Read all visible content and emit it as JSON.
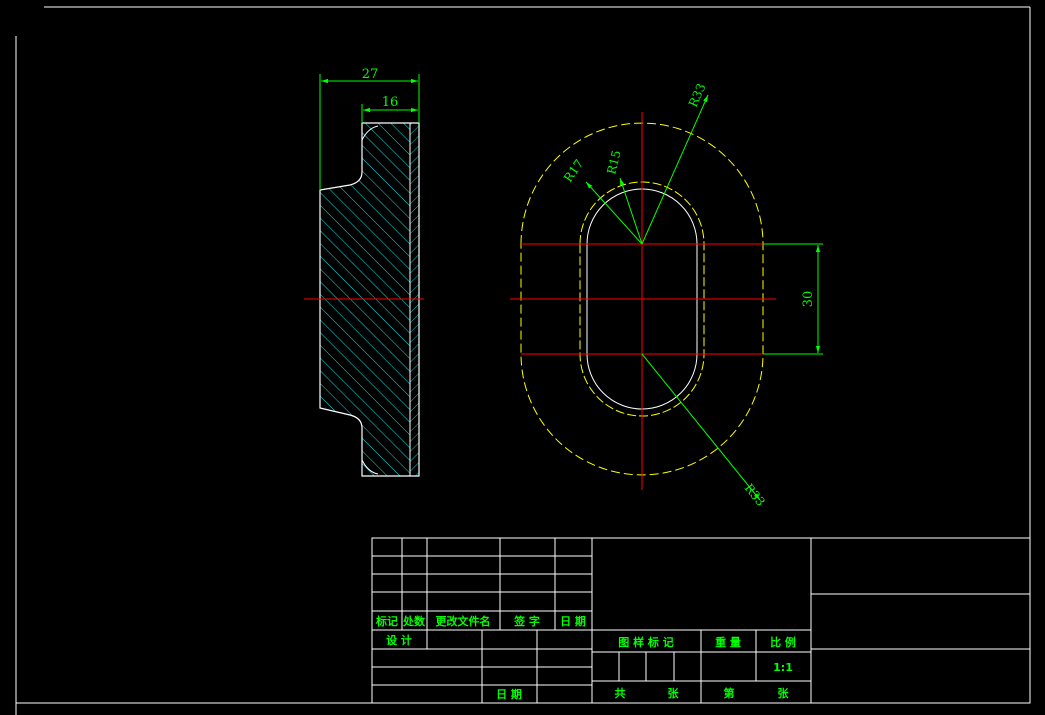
{
  "drawing": {
    "dimensions": {
      "overall_thickness": "27",
      "flange_thickness": "16",
      "slot_spacing": "30",
      "outer_radius_top": "R33",
      "outer_radius_bottom": "R33",
      "inner_radius_outer_groove": "R17",
      "inner_radius_inner_groove": "R15"
    }
  },
  "title_block": {
    "rev_headers": {
      "mark": "标记",
      "count": "处数",
      "doc_name": "更改文件名",
      "signature": "签 字",
      "date": "日 期"
    },
    "design_label": "设 计",
    "date_label": "日 期",
    "drawing_mark_label": "图 样 标 记",
    "weight_label": "重 量",
    "scale_label": "比 例",
    "scale_value": "1:1",
    "total_label": "共",
    "sheet_unit_label": "张",
    "page_label": "第",
    "page_unit_label": "张"
  },
  "colors": {
    "background": "#000000",
    "border": "#ffffff",
    "outline": "#ffffff",
    "dimension": "#00ff00",
    "centerline": "#ff0000",
    "hidden": "#ffff00",
    "hatch": "#00ffff"
  }
}
